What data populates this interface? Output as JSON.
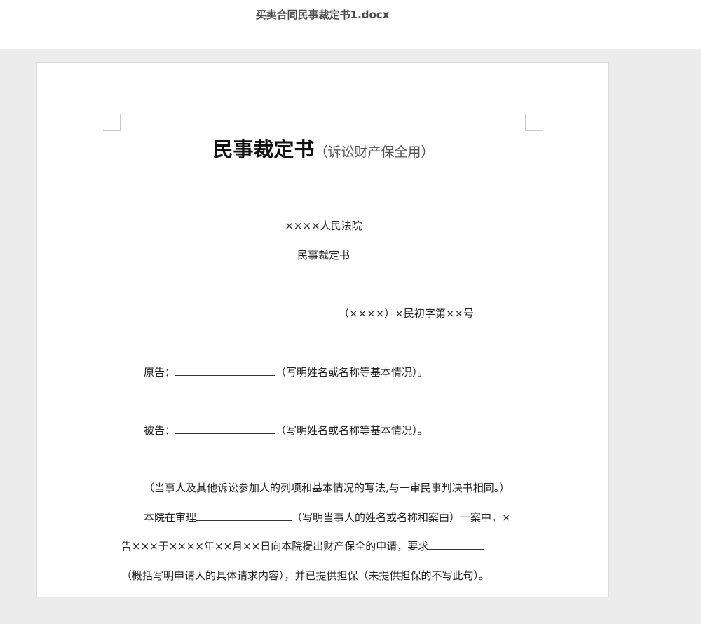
{
  "window": {
    "title": "买卖合同民事裁定书1.docx"
  },
  "document": {
    "heading_main": "民事裁定书",
    "heading_sub": "（诉讼财产保全用）",
    "court_name": "××××人民法院",
    "doc_type": "民事裁定书",
    "case_number": "（××××）×民初字第××号",
    "plaintiff_label": "原告：",
    "plaintiff_note": "（写明姓名或名称等基本情况）。",
    "defendant_label": "被告：",
    "defendant_note": "（写明姓名或名称等基本情况）。",
    "parties_note": "（当事人及其他诉讼参加人的列项和基本情况的写法,与一审民事判决书相同。）",
    "body_line1_a": "本院在审理",
    "body_line1_b": "（写明当事人的姓名或名称和案由）一案中，×",
    "body_line2_a": "告×××于××××年××月××日向本院提出财产保全的申请，要求",
    "body_line3": "（概括写明申请人的具体请求内容），并已提供担保（未提供担保的不写此句）。"
  }
}
